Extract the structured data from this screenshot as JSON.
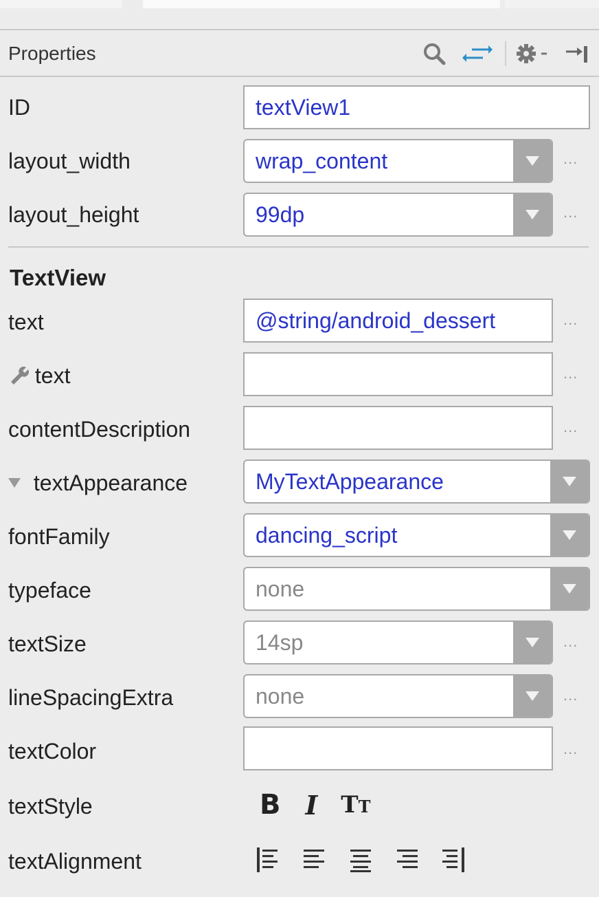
{
  "panel": {
    "title": "Properties",
    "icons": [
      "search-icon",
      "swap-arrows-icon",
      "gear-dropdown-icon",
      "collapse-panel-icon"
    ]
  },
  "rows": {
    "id": {
      "label": "ID",
      "value": "textView1"
    },
    "layout_width": {
      "label": "layout_width",
      "value": "wrap_content"
    },
    "layout_height": {
      "label": "layout_height",
      "value": "99dp"
    }
  },
  "section": {
    "title": "TextView"
  },
  "textview": {
    "text": {
      "label": "text",
      "value": "@string/android_dessert"
    },
    "tools_text": {
      "label": "text",
      "value": "",
      "icon": "wrench-icon"
    },
    "contentDescription": {
      "label": "contentDescription",
      "value": ""
    },
    "textAppearance": {
      "label": "textAppearance",
      "value": "MyTextAppearance",
      "icon": "expand-triangle-icon"
    },
    "fontFamily": {
      "label": "fontFamily",
      "value": "dancing_script"
    },
    "typeface": {
      "label": "typeface",
      "value": "none"
    },
    "textSize": {
      "label": "textSize",
      "value": "14sp"
    },
    "lineSpacingExtra": {
      "label": "lineSpacingExtra",
      "value": "none"
    },
    "textColor": {
      "label": "textColor",
      "value": ""
    },
    "textStyle": {
      "label": "textStyle",
      "buttons": [
        "B",
        "I",
        "Tt"
      ]
    },
    "textAlignment": {
      "label": "textAlignment",
      "icons": [
        "align-start-icon",
        "align-left-icon",
        "align-center-icon",
        "align-right-icon",
        "align-end-icon"
      ]
    }
  },
  "ellipsis": "...",
  "colors": {
    "value_blue": "#2a34c8",
    "placeholder_gray": "#888888",
    "accent_teal": "#2b8fc9"
  }
}
